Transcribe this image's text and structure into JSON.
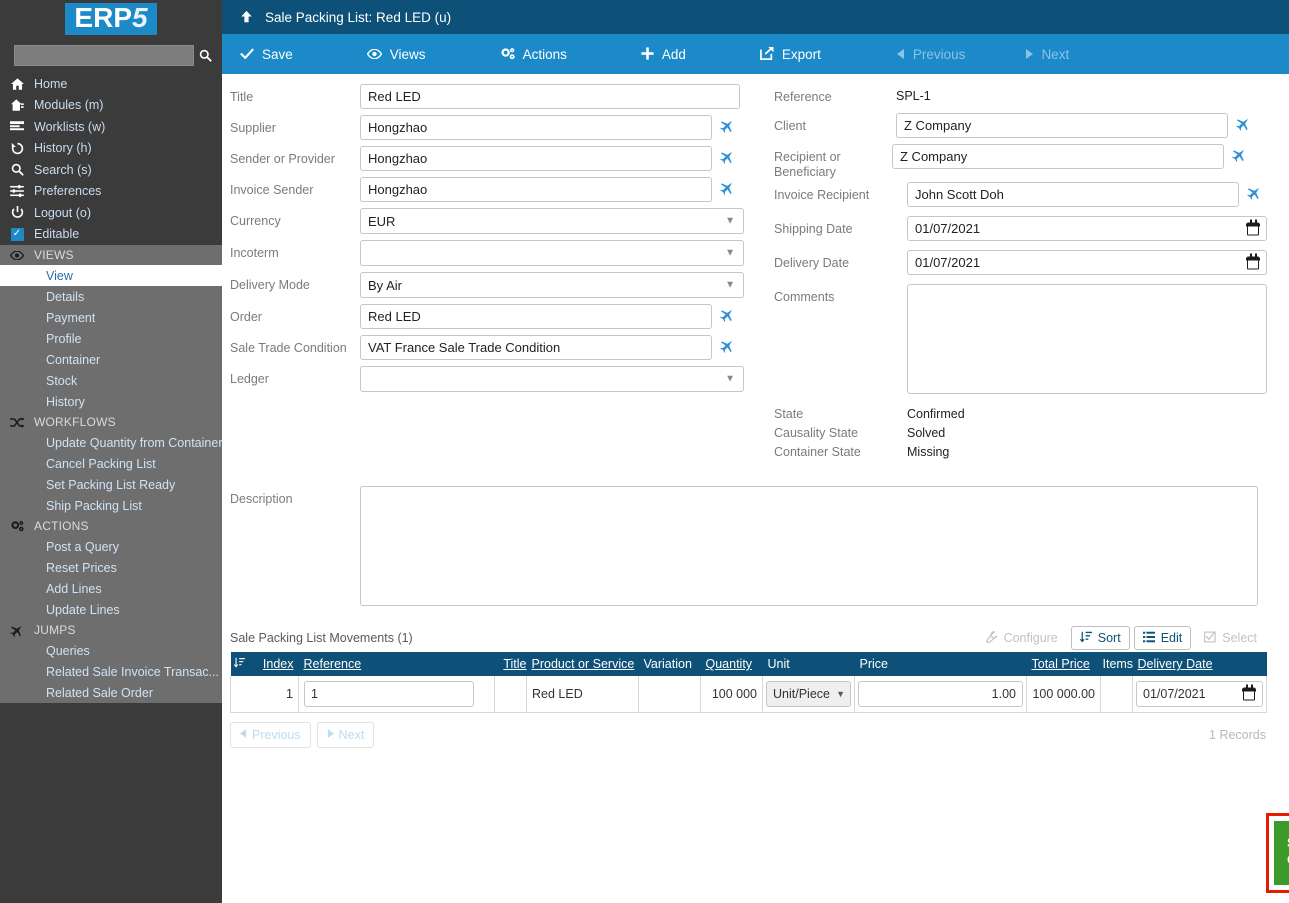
{
  "brand": {
    "name_part1": "ERP",
    "name_part2": "5",
    "accent": "#1c8ac9"
  },
  "sidebar": {
    "search_placeholder": "",
    "search_value": "",
    "search_icon": "search-icon",
    "top_items": [
      {
        "icon": "home-icon",
        "label": "Home"
      },
      {
        "icon": "modules-icon",
        "label": "Modules (m)"
      },
      {
        "icon": "worklists-icon",
        "label": "Worklists (w)"
      },
      {
        "icon": "history-icon",
        "label": "History (h)"
      },
      {
        "icon": "search-icon",
        "label": "Search (s)"
      },
      {
        "icon": "preferences-icon",
        "label": "Preferences"
      },
      {
        "icon": "power-icon",
        "label": "Logout (o)"
      },
      {
        "icon": "checkbox-checked-icon",
        "label": "Editable"
      }
    ],
    "sections": [
      {
        "icon": "eye-icon",
        "title": "VIEWS",
        "items": [
          {
            "label": "View",
            "active": true
          },
          {
            "label": "Details",
            "active": false
          },
          {
            "label": "Payment",
            "active": false
          },
          {
            "label": "Profile",
            "active": false
          },
          {
            "label": "Container",
            "active": false
          },
          {
            "label": "Stock",
            "active": false
          },
          {
            "label": "History",
            "active": false
          }
        ]
      },
      {
        "icon": "shuffle-icon",
        "title": "WORKFLOWS",
        "items": [
          {
            "label": "Update Quantity from Container",
            "active": false
          },
          {
            "label": "Cancel Packing List",
            "active": false
          },
          {
            "label": "Set Packing List Ready",
            "active": false
          },
          {
            "label": "Ship Packing List",
            "active": false
          }
        ]
      },
      {
        "icon": "gear-icon",
        "title": "ACTIONS",
        "items": [
          {
            "label": "Post a Query",
            "active": false
          },
          {
            "label": "Reset Prices",
            "active": false
          },
          {
            "label": "Add Lines",
            "active": false
          },
          {
            "label": "Update Lines",
            "active": false
          }
        ]
      },
      {
        "icon": "plane-icon",
        "title": "JUMPS",
        "items": [
          {
            "label": "Queries",
            "active": false
          },
          {
            "label": "Related Sale Invoice Transac...",
            "active": false
          },
          {
            "label": "Related Sale Order",
            "active": false
          }
        ]
      }
    ]
  },
  "titlebar": {
    "icon": "arrow-up-icon",
    "title": "Sale Packing List: Red LED (u)"
  },
  "toolbar": {
    "buttons": [
      {
        "icon": "check-icon",
        "label": "Save",
        "disabled": false
      },
      {
        "icon": "eye-icon",
        "label": "Views",
        "disabled": false
      },
      {
        "icon": "gear-icon",
        "label": "Actions",
        "disabled": false
      },
      {
        "icon": "plus-icon",
        "label": "Add",
        "disabled": false
      },
      {
        "icon": "export-icon",
        "label": "Export",
        "disabled": false
      },
      {
        "icon": "triangle-left-icon",
        "label": "Previous",
        "disabled": true
      },
      {
        "icon": "triangle-right-icon",
        "label": "Next",
        "disabled": true
      }
    ]
  },
  "form": {
    "left": {
      "title_label": "Title",
      "title_value": "Red LED",
      "supplier_label": "Supplier",
      "supplier_value": "Hongzhao",
      "sender_label": "Sender or Provider",
      "sender_value": "Hongzhao",
      "invoice_sender_label": "Invoice Sender",
      "invoice_sender_value": "Hongzhao",
      "currency_label": "Currency",
      "currency_value": "EUR",
      "incoterm_label": "Incoterm",
      "incoterm_value": "",
      "delivery_mode_label": "Delivery Mode",
      "delivery_mode_value": "By Air",
      "order_label": "Order",
      "order_value": "Red LED",
      "trade_condition_label": "Sale Trade Condition",
      "trade_condition_value": "VAT France Sale Trade Condition",
      "ledger_label": "Ledger",
      "ledger_value": ""
    },
    "right": {
      "reference_label": "Reference",
      "reference_value": "SPL-1",
      "client_label": "Client",
      "client_value": "Z Company",
      "recipient_label": "Recipient or Beneficiary",
      "recipient_value": "Z Company",
      "invoice_recipient_label": "Invoice Recipient",
      "invoice_recipient_value": "John Scott Doh",
      "shipping_date_label": "Shipping Date",
      "shipping_date_value": "01/07/2021",
      "delivery_date_label": "Delivery Date",
      "delivery_date_value": "01/07/2021",
      "comments_label": "Comments",
      "comments_value": "",
      "state_label": "State",
      "state_value": "Confirmed",
      "causality_state_label": "Causality State",
      "causality_state_value": "Solved",
      "container_state_label": "Container State",
      "container_state_value": "Missing"
    },
    "description_label": "Description",
    "description_value": ""
  },
  "listbox": {
    "title": "Sale Packing List Movements (1)",
    "buttons": [
      {
        "icon": "wrench-icon",
        "label": "Configure",
        "enabled": false
      },
      {
        "icon": "sort-icon",
        "label": "Sort",
        "enabled": true
      },
      {
        "icon": "list-icon",
        "label": "Edit",
        "enabled": true
      },
      {
        "icon": "checkbox-icon",
        "label": "Select",
        "enabled": false
      }
    ],
    "columns": [
      {
        "label": "Index",
        "sortable": true,
        "align": "left"
      },
      {
        "label": "Reference",
        "sortable": true,
        "align": "left"
      },
      {
        "label": "Title",
        "sortable": true,
        "align": "right"
      },
      {
        "label": "Product or Service",
        "sortable": true,
        "align": "left"
      },
      {
        "label": "Variation",
        "sortable": false,
        "align": "left"
      },
      {
        "label": "Quantity",
        "sortable": true,
        "align": "left"
      },
      {
        "label": "Unit",
        "sortable": false,
        "align": "left"
      },
      {
        "label": "Price",
        "sortable": false,
        "align": "left"
      },
      {
        "label": "Total Price",
        "sortable": true,
        "align": "left"
      },
      {
        "label": "Items",
        "sortable": false,
        "align": "left"
      },
      {
        "label": "Delivery Date",
        "sortable": true,
        "align": "left"
      }
    ],
    "rows": [
      {
        "index": "1",
        "reference": "1",
        "title": "",
        "product": "Red LED",
        "variation": "",
        "quantity": "100 000",
        "unit": "Unit/Piece",
        "price": "1.00",
        "total_price": "100 000.00",
        "items": "",
        "delivery_date": "01/07/2021"
      }
    ],
    "pagination": {
      "previous_label": "Previous",
      "next_label": "Next",
      "records_label": "1 Records"
    }
  },
  "notification": {
    "message": "Sale Packing List related to Sale Order : Red LED.",
    "background": "#3c9b28",
    "outline": "#e51b00"
  }
}
